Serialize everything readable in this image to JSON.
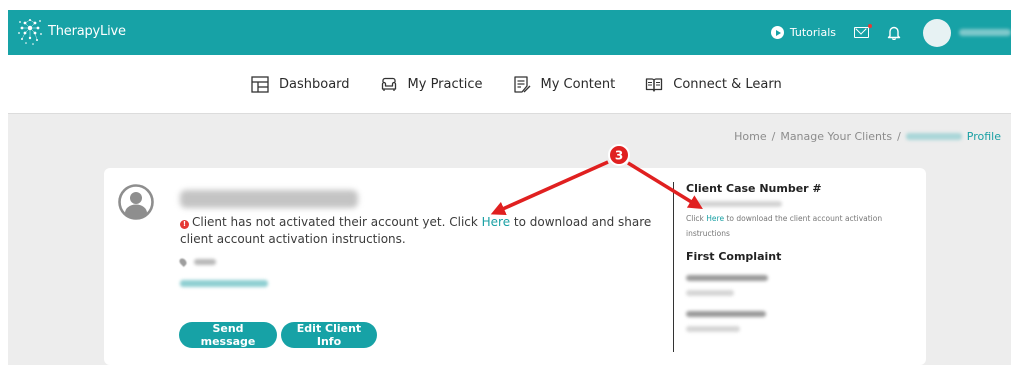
{
  "app": {
    "name": "TherapyLive"
  },
  "header": {
    "tutorials_label": "Tutorials"
  },
  "nav": {
    "items": [
      {
        "label": "Dashboard",
        "icon": "dashboard-icon"
      },
      {
        "label": "My Practice",
        "icon": "sofa-icon"
      },
      {
        "label": "My Content",
        "icon": "content-icon"
      },
      {
        "label": "Connect & Learn",
        "icon": "book-icon"
      }
    ]
  },
  "breadcrumb": {
    "home": "Home",
    "sep": "/",
    "manage": "Manage Your Clients",
    "current": "Profile"
  },
  "client": {
    "alert_prefix": "Client has not activated their account yet. Click ",
    "alert_link": "Here",
    "alert_suffix": " to download and share client account activation instructions.",
    "send_message": "Send message",
    "edit_info": "Edit Client Info"
  },
  "case": {
    "title": "Client Case Number #",
    "click": "Click ",
    "link": "Here",
    "suffix": " to download the client account activation instructions",
    "first_complaint": "First Complaint"
  },
  "annotation": {
    "step": "3",
    "color": "#e02020"
  },
  "colors": {
    "brand": "#17a2a6",
    "background": "#ededed",
    "alert": "#e53935"
  }
}
